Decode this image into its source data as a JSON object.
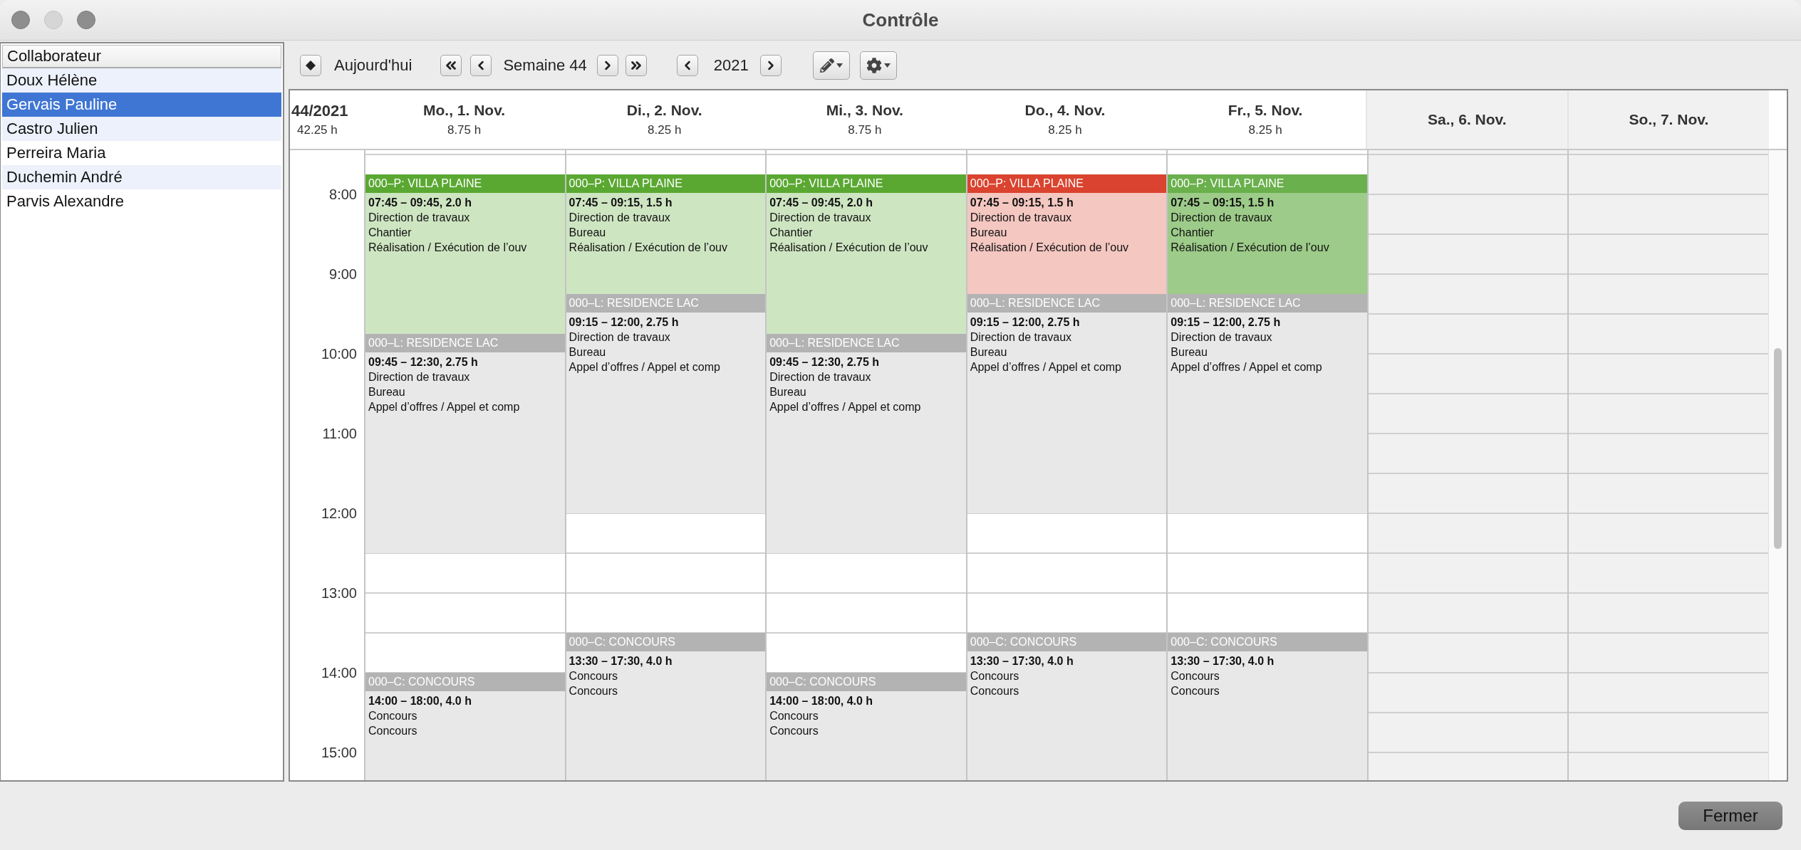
{
  "window": {
    "title": "Contrôle"
  },
  "employees": {
    "column": "Collaborateur",
    "items": [
      {
        "name": "Doux Hélène",
        "selected": false
      },
      {
        "name": "Gervais Pauline",
        "selected": true
      },
      {
        "name": "Castro Julien",
        "selected": false
      },
      {
        "name": "Perreira Maria",
        "selected": false
      },
      {
        "name": "Duchemin André",
        "selected": false
      },
      {
        "name": "Parvis Alexandre",
        "selected": false
      }
    ]
  },
  "toolbar": {
    "today": "Aujourd'hui",
    "week": "Semaine 44",
    "year": "2021"
  },
  "calendar": {
    "week": "44/2021",
    "total": "42.25 h",
    "hours": [
      "8:00",
      "9:00",
      "10:00",
      "11:00",
      "12:00",
      "13:00",
      "14:00",
      "15:00"
    ],
    "days": [
      {
        "label": "Mo., 1. Nov.",
        "total": "8.75 h",
        "weekend": false,
        "events": [
          {
            "title": "000–P: VILLA PLAINE",
            "color": "#5aa832",
            "kind": "light",
            "time": "07:45 – 09:45, 2.0 h",
            "lines": [
              "Direction de travaux",
              "Chantier",
              "Réalisation / Exécution de l’ouv"
            ]
          },
          {
            "title": "000–L: RESIDENCE LAC",
            "color": "#b3b3b3",
            "kind": "light",
            "time": "09:45 – 12:30, 2.75 h",
            "lines": [
              "Direction de travaux",
              "Bureau",
              "Appel d’offres / Appel et comp"
            ]
          },
          {
            "title": "000–C: CONCOURS",
            "color": "#b3b3b3",
            "kind": "light",
            "time": "14:00 – 18:00, 4.0 h",
            "lines": [
              "Concours",
              "Concours"
            ]
          }
        ]
      },
      {
        "label": "Di., 2. Nov.",
        "total": "8.25 h",
        "weekend": false,
        "events": [
          {
            "title": "000–P: VILLA PLAINE",
            "color": "#5aa832",
            "kind": "light",
            "time": "07:45 – 09:15, 1.5 h",
            "lines": [
              "Direction de travaux",
              "Bureau",
              "Réalisation / Exécution de l’ouv"
            ]
          },
          {
            "title": "000–L: RESIDENCE LAC",
            "color": "#b3b3b3",
            "kind": "light",
            "time": "09:15 – 12:00, 2.75 h",
            "lines": [
              "Direction de travaux",
              "Bureau",
              "Appel d’offres / Appel et comp"
            ]
          },
          {
            "title": "000–C: CONCOURS",
            "color": "#b3b3b3",
            "kind": "light",
            "time": "13:30 – 17:30, 4.0 h",
            "lines": [
              "Concours",
              "Concours"
            ]
          }
        ]
      },
      {
        "label": "Mi., 3. Nov.",
        "total": "8.75 h",
        "weekend": false,
        "events": [
          {
            "title": "000–P: VILLA PLAINE",
            "color": "#5aa832",
            "kind": "light",
            "time": "07:45 – 09:45, 2.0 h",
            "lines": [
              "Direction de travaux",
              "Chantier",
              "Réalisation / Exécution de l’ouv"
            ]
          },
          {
            "title": "000–L: RESIDENCE LAC",
            "color": "#b3b3b3",
            "kind": "light",
            "time": "09:45 – 12:30, 2.75 h",
            "lines": [
              "Direction de travaux",
              "Bureau",
              "Appel d’offres / Appel et comp"
            ]
          },
          {
            "title": "000–C: CONCOURS",
            "color": "#b3b3b3",
            "kind": "light",
            "time": "14:00 – 18:00, 4.0 h",
            "lines": [
              "Concours",
              "Concours"
            ]
          }
        ]
      },
      {
        "label": "Do., 4. Nov.",
        "total": "8.25 h",
        "weekend": false,
        "events": [
          {
            "title": "000–P: VILLA PLAINE",
            "color": "#d9432f",
            "kind": "light",
            "time": "07:45 – 09:15, 1.5 h",
            "lines": [
              "Direction de travaux",
              "Bureau",
              "Réalisation / Exécution de l’ouv"
            ]
          },
          {
            "title": "000–L: RESIDENCE LAC",
            "color": "#b3b3b3",
            "kind": "light",
            "time": "09:15 – 12:00, 2.75 h",
            "lines": [
              "Direction de travaux",
              "Bureau",
              "Appel d’offres / Appel et comp"
            ]
          },
          {
            "title": "000–C: CONCOURS",
            "color": "#b3b3b3",
            "kind": "light",
            "time": "13:30 – 17:30, 4.0 h",
            "lines": [
              "Concours",
              "Concours"
            ]
          }
        ]
      },
      {
        "label": "Fr., 5. Nov.",
        "total": "8.25 h",
        "weekend": false,
        "events": [
          {
            "title": "000–P: VILLA PLAINE",
            "color": "#6ab04c",
            "kind": "strong",
            "time": "07:45 – 09:15, 1.5 h",
            "lines": [
              "Direction de travaux",
              "Chantier",
              "Réalisation / Exécution de l’ouv"
            ]
          },
          {
            "title": "000–L: RESIDENCE LAC",
            "color": "#b3b3b3",
            "kind": "light",
            "time": "09:15 – 12:00, 2.75 h",
            "lines": [
              "Direction de travaux",
              "Bureau",
              "Appel d’offres / Appel et comp"
            ]
          },
          {
            "title": "000–C: CONCOURS",
            "color": "#b3b3b3",
            "kind": "light",
            "time": "13:30 – 17:30, 4.0 h",
            "lines": [
              "Concours",
              "Concours"
            ]
          }
        ]
      },
      {
        "label": "Sa., 6. Nov.",
        "weekend": true
      },
      {
        "label": "So., 7. Nov.",
        "weekend": true
      }
    ]
  },
  "buttons": {
    "close": "Fermer"
  }
}
